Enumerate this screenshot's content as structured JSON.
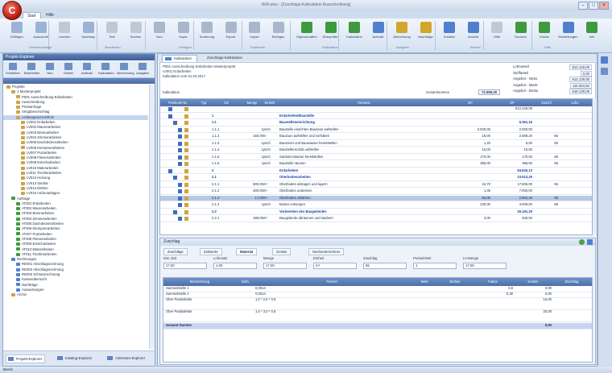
{
  "window": {
    "title": "AVA-plus - [Zuschlags-Kalkulation Ausschreibung]"
  },
  "app_orb": "C",
  "ribbon_tabs": [
    "Start",
    "Hilfe"
  ],
  "ribbon": {
    "buttons": [
      "Einfügen",
      "Ausschnitt",
      "Löschen",
      "Nachtrag",
      "Text",
      "Suchen",
      "Neu",
      "Kopie",
      "Sortierung",
      "Export",
      "Import",
      "Einfügen",
      "Eigenschaften",
      "Überprüfen",
      "Kalkulation",
      "Aufmaß",
      "Abrechnung",
      "Nachträge",
      "Zusätze",
      "Ansicht",
      "Hilfe",
      "Drucken",
      "Extras",
      "Einstellungen",
      "Info"
    ],
    "groups": [
      "Zwischenablage",
      "Bearbeiten",
      "Einfügen",
      "Positionen",
      "Kalkulation",
      "Ausgabe",
      "Ansicht",
      "Hilfe"
    ]
  },
  "left_panel": {
    "title": "Projekt-Explorer",
    "toolbar": [
      "Schließen",
      "Bearbeiten",
      "Neu",
      "Ordner",
      "Aufmaß",
      "Kalkulation",
      "Abrechnung",
      "Ausgabe"
    ],
    "tree": [
      {
        "label": "Projekte",
        "kind": "folder",
        "level": 0
      },
      {
        "label": "1 Musterprojekt",
        "kind": "folder",
        "level": 1
      },
      {
        "label": "P001 Ausschreibung Erdarbeiten",
        "kind": "folder",
        "level": 2
      },
      {
        "label": "Ausschreibung",
        "kind": "doc",
        "level": 2
      },
      {
        "label": "Preisanfrage",
        "kind": "doc",
        "level": 2
      },
      {
        "label": "Vergabevorschlag",
        "kind": "doc",
        "level": 2
      },
      {
        "label": "Leistungsverzeichnis",
        "kind": "sel",
        "level": 2
      },
      {
        "label": "LV001 Erdarbeiten",
        "kind": "doc",
        "level": 3
      },
      {
        "label": "LV002 Maurerarbeiten",
        "kind": "doc",
        "level": 3
      },
      {
        "label": "LV003 Betonarbeiten",
        "kind": "doc",
        "level": 3
      },
      {
        "label": "LV004 Zimmerarbeiten",
        "kind": "doc",
        "level": 3
      },
      {
        "label": "LV005 Dachdeckerarbeiten",
        "kind": "doc",
        "level": 3
      },
      {
        "label": "LV006 Klempnerarbeiten",
        "kind": "doc",
        "level": 3
      },
      {
        "label": "LV007 Putzarbeiten",
        "kind": "doc",
        "level": 3
      },
      {
        "label": "LV008 Fliesenarbeiten",
        "kind": "doc",
        "level": 3
      },
      {
        "label": "LV009 Estricharbeiten",
        "kind": "doc",
        "level": 3
      },
      {
        "label": "LV010 Malerarbeiten",
        "kind": "doc",
        "level": 3
      },
      {
        "label": "LV011 Tischlerarbeiten",
        "kind": "doc",
        "level": 3
      },
      {
        "label": "LV012 Heizung",
        "kind": "doc",
        "level": 3
      },
      {
        "label": "LV013 Sanitär",
        "kind": "doc",
        "level": 3
      },
      {
        "label": "LV014 Elektro",
        "kind": "doc",
        "level": 3
      },
      {
        "label": "LV015 Außenanlagen",
        "kind": "doc",
        "level": 3
      },
      {
        "label": "Aufträge",
        "kind": "green",
        "level": 1
      },
      {
        "label": "AT001 Erdarbeiten",
        "kind": "green",
        "level": 2
      },
      {
        "label": "AT002 Maurerarbeiten",
        "kind": "green",
        "level": 2
      },
      {
        "label": "AT003 Betonarbeiten",
        "kind": "green",
        "level": 2
      },
      {
        "label": "AT004 Zimmerarbeiten",
        "kind": "green",
        "level": 2
      },
      {
        "label": "AT005 Dachdeckerarbeiten",
        "kind": "green",
        "level": 2
      },
      {
        "label": "AT006 Klempnerarbeiten",
        "kind": "green",
        "level": 2
      },
      {
        "label": "AT007 Putzarbeiten",
        "kind": "green",
        "level": 2
      },
      {
        "label": "AT008 Fliesenarbeiten",
        "kind": "green",
        "level": 2
      },
      {
        "label": "AT009 Estricharbeiten",
        "kind": "green",
        "level": 2
      },
      {
        "label": "AT010 Malerarbeiten",
        "kind": "green",
        "level": 2
      },
      {
        "label": "AT011 Tischlerarbeiten",
        "kind": "green",
        "level": 2
      },
      {
        "label": "Rechnungen",
        "kind": "blue",
        "level": 1
      },
      {
        "label": "RE001 Abschlagsrechnung",
        "kind": "blue",
        "level": 2
      },
      {
        "label": "RE002 Abschlagsrechnung",
        "kind": "blue",
        "level": 2
      },
      {
        "label": "RE003 Schlussrechnung",
        "kind": "blue",
        "level": 2
      },
      {
        "label": "Kostenübersicht",
        "kind": "blue",
        "level": 2
      },
      {
        "label": "Nachträge",
        "kind": "blue",
        "level": 2
      },
      {
        "label": "Auswertungen",
        "kind": "blue",
        "level": 2
      },
      {
        "label": "Archiv",
        "kind": "folder",
        "level": 1
      }
    ],
    "bottom_tabs": [
      "Projekt-Explorer",
      "Katalog-Explorer",
      "Adressen-Explorer"
    ]
  },
  "main": {
    "doc_tabs": [
      "Kalkulation",
      "Zuschlags-Kalkulation"
    ],
    "info_lines": [
      "P001 Ausschreibung Erdarbeiten Musterprojekt",
      "LV001 Erdarbeiten",
      "Kalkulation vom 01.03.2017",
      "",
      "Kalkulation"
    ],
    "info_total_label": "Gesamtsumme",
    "info_total_value": "72.995,00",
    "info_right": [
      {
        "label": "Lohnanteil",
        "value": "812.129,05"
      },
      {
        "label": "Stoffanteil",
        "value": "0,00"
      },
      {
        "label": "Angebot - Netto",
        "value": "612.129,05"
      },
      {
        "label": "Angebot - MwSt",
        "value": "116.304,52"
      },
      {
        "label": "Angebot - Brutto",
        "value": "618.129,05"
      }
    ],
    "grid_headers": [
      "Positions-Nr.",
      "Typ",
      "OZ",
      "Menge",
      "Einheit",
      "Kurztext",
      "EP",
      "GP",
      "Zuschl.",
      "Lohn"
    ],
    "grid_rows": [
      {
        "oz": "",
        "menge": "",
        "einheit": "",
        "text": "",
        "ep": "",
        "gp": "612.129,05",
        "z": "",
        "l": "",
        "style": ""
      },
      {
        "oz": "1",
        "menge": "",
        "einheit": "",
        "text": "Erdarbeiten/Baustelle",
        "ep": "",
        "gp": "",
        "z": "",
        "l": "",
        "style": "blue"
      },
      {
        "oz": "1.1",
        "menge": "",
        "einheit": "",
        "text": "Baustelleneinrichtung",
        "ep": "",
        "gp": "6.361,16",
        "z": "",
        "l": "",
        "style": "blue"
      },
      {
        "oz": "1.1.1",
        "menge": "1",
        "einheit": "psch",
        "text": "Baustelle einrichten Bauzaun aufstellen",
        "ep": "2.000,00",
        "gp": "2.000,00",
        "z": "",
        "l": "",
        "style": ""
      },
      {
        "oz": "1.1.2",
        "menge": "150,00",
        "einheit": "m",
        "text": "Bauzaun aufstellen und vorhalten",
        "ep": "18,00",
        "gp": "2.689,20",
        "z": "65",
        "l": "",
        "style": ""
      },
      {
        "oz": "1.1.3",
        "menge": "1",
        "einheit": "psch",
        "text": "Baustrom und Bauwasser bereitstellen",
        "ep": "1,20",
        "gp": "8,00",
        "z": "65",
        "l": "",
        "style": ""
      },
      {
        "oz": "1.1.4",
        "menge": "1",
        "einheit": "psch",
        "text": "Baustellenschild aufstellen",
        "ep": "15,00",
        "gp": "15,00",
        "z": "",
        "l": "",
        "style": ""
      },
      {
        "oz": "1.1.5",
        "menge": "1",
        "einheit": "psch",
        "text": "Sanitärcontainer bereitstellen",
        "ep": "170,00",
        "gp": "170,00",
        "z": "65",
        "l": "",
        "style": ""
      },
      {
        "oz": "1.1.6",
        "menge": "1",
        "einheit": "psch",
        "text": "Baustelle räumen",
        "ep": "386,00",
        "gp": "386,00",
        "z": "65",
        "l": "",
        "style": ""
      },
      {
        "oz": "2",
        "menge": "",
        "einheit": "",
        "text": "Erdarbeiten",
        "ep": "",
        "gp": "84.840,13",
        "z": "",
        "l": "",
        "style": "blue"
      },
      {
        "oz": "2.1",
        "menge": "",
        "einheit": "",
        "text": "Oberbodenarbeiten",
        "ep": "",
        "gp": "23.513,26",
        "z": "",
        "l": "",
        "style": "blue"
      },
      {
        "oz": "2.1.1",
        "menge": "500,00",
        "einheit": "m²",
        "text": "Oberboden abtragen und lagern",
        "ep": "16,70",
        "gp": "17.605,00",
        "z": "65",
        "l": "",
        "style": ""
      },
      {
        "oz": "2.1.2",
        "menge": "500,00",
        "einheit": "m²",
        "text": "Oberboden andecken",
        "ep": "1,35",
        "gp": "7.000,00",
        "z": "",
        "l": "",
        "style": ""
      },
      {
        "oz": "2.1.3",
        "menge": "17,00",
        "einheit": "m³",
        "text": "Oberboden abfahren",
        "ep": "56,00",
        "gp": "2.962,26",
        "z": "65",
        "l": "",
        "style": "sel"
      },
      {
        "oz": "2.1.4",
        "menge": "1",
        "einheit": "psch",
        "text": "Boden entsorgen",
        "ep": "230,00",
        "gp": "4.009,00",
        "z": "65",
        "l": "",
        "style": ""
      },
      {
        "oz": "2.2",
        "menge": "",
        "einheit": "",
        "text": "Vorbereiten des Baugeländes",
        "ep": "",
        "gp": "26.181,25",
        "z": "",
        "l": "",
        "style": "blue"
      },
      {
        "oz": "2.2.1",
        "menge": "280,00",
        "einheit": "m²",
        "text": "Baugelände abräumen und säubern",
        "ep": "3,00",
        "gp": "840,00",
        "z": "",
        "l": "",
        "style": ""
      }
    ],
    "bottom": {
      "title": "Zuschlag",
      "tabs": [
        "Zuschläge",
        "Zeitwerte",
        "Material",
        "Geräte",
        "Nachunternehmer"
      ],
      "form": {
        "labels": [
          "Dat. Zeit",
          "Lohnsatz",
          "Menge",
          "Einheit",
          "Zuschlag",
          "Preiseinheit",
          "LV-Menge"
        ],
        "values": [
          "17,00",
          "1,00",
          "17,00",
          "m³",
          "65",
          "1",
          "17,00"
        ]
      },
      "sub_headers": [
        "Bezeichnung",
        "Einh.",
        "Formel",
        "Wert",
        "Einheit",
        "Faktor",
        "Kosten",
        "Zuschlag"
      ],
      "sub_rows": [
        {
          "name": "Sammelstelle 1",
          "formel": "0,0014",
          "wert": "0,8",
          "faktor": "0,00"
        },
        {
          "name": "Sammelstelle 2",
          "formel": "0,0014",
          "wert": "0,38",
          "faktor": "0,00"
        },
        {
          "name": "Ober Pandaleiste",
          "formel": "1,0 * 2,5 * 0,8",
          "wert": "",
          "faktor": "15,00"
        },
        {
          "name": "Ober Pandaleiste",
          "formel": "1,0 * 3,0 * 0,8",
          "wert": "",
          "faktor": "25,00"
        }
      ],
      "total_label": "Gesamt-Summe",
      "total_value": "0,00"
    }
  },
  "status": "Bereit"
}
